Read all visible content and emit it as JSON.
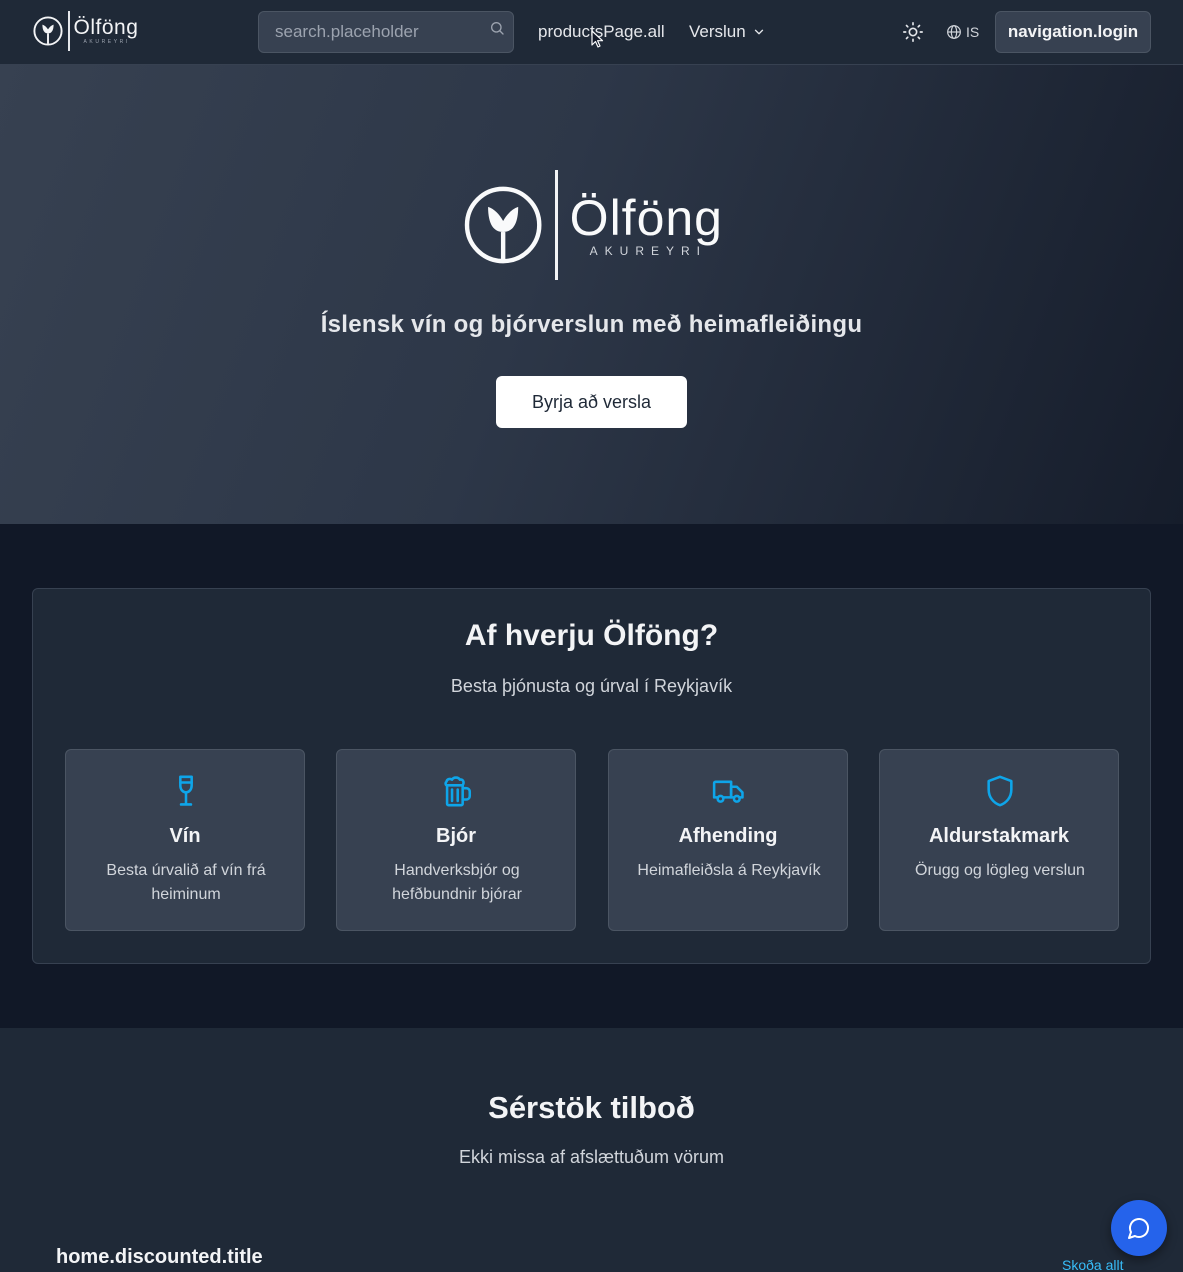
{
  "header": {
    "logo": {
      "name": "Ölföng",
      "city": "AKUREYRI"
    },
    "search": {
      "placeholder": "search.placeholder",
      "value": ""
    },
    "nav": {
      "all_products": "productsPage.all",
      "store": "Verslun"
    },
    "language": "IS",
    "login_label": "navigation.login"
  },
  "hero": {
    "logo": {
      "name": "Ölföng",
      "city": "AKUREYRI"
    },
    "tagline": "Íslensk vín og bjórverslun með heimafleiðingu",
    "cta_label": "Byrja að versla"
  },
  "why": {
    "title": "Af hverju Ölföng?",
    "subtitle": "Besta þjónusta og úrval í Reykjavík",
    "features": [
      {
        "icon": "wine-glass-icon",
        "title": "Vín",
        "description": "Besta úrvalið af vín frá heiminum"
      },
      {
        "icon": "beer-mug-icon",
        "title": "Bjór",
        "description": "Handverksbjór og hefðbundnir bjórar"
      },
      {
        "icon": "truck-icon",
        "title": "Afhending",
        "description": "Heimafleiðsla á Reykjavík"
      },
      {
        "icon": "shield-icon",
        "title": "Aldurstakmark",
        "description": "Örugg og lögleg verslun"
      }
    ]
  },
  "offers": {
    "title": "Sérstök tilboð",
    "subtitle": "Ekki missa af afslættuðum vörum",
    "discounted_title": "home.discounted.title",
    "view_all": "Skoða allt"
  },
  "colors": {
    "accent": "#0ea5e9",
    "header_bg": "#1f2937",
    "page_bg": "#111827",
    "chat_button": "#2563eb"
  }
}
